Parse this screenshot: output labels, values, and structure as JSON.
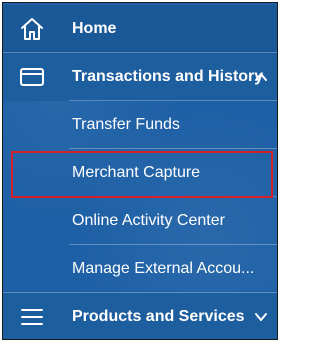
{
  "nav": {
    "home": {
      "label": "Home",
      "icon": "home-icon"
    },
    "transactions": {
      "label": "Transactions and History",
      "icon": "card-icon",
      "expanded": true,
      "chevron": "chevron-up-icon",
      "subitems": [
        {
          "label": "Transfer Funds"
        },
        {
          "label": "Merchant Capture"
        },
        {
          "label": "Online Activity Center"
        },
        {
          "label": "Manage External Accou..."
        }
      ]
    },
    "products": {
      "label": "Products and Services",
      "icon": "menu-icon",
      "chevron": "chevron-down-icon"
    }
  },
  "colors": {
    "background": "#1e60a6",
    "highlight_border": "#d3222a",
    "text": "#ffffff"
  }
}
